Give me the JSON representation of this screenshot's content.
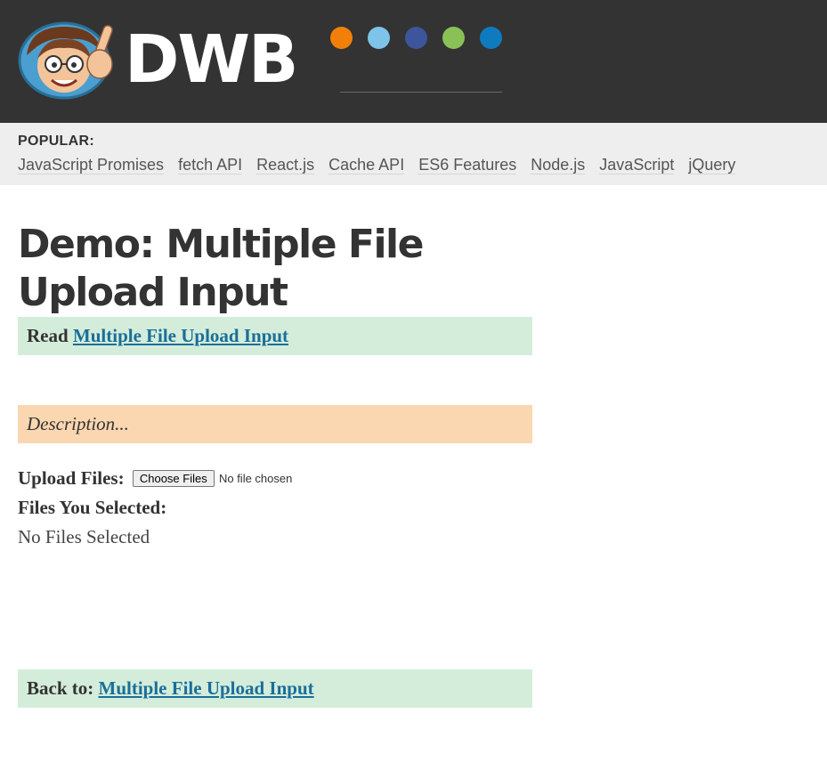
{
  "header": {
    "logo_text": "DWB",
    "mascot": "david-walsh-mascot",
    "dots": [
      {
        "name": "orange-dot",
        "color": "#f28008"
      },
      {
        "name": "lightblue-dot",
        "color": "#7dc4e8"
      },
      {
        "name": "navy-dot",
        "color": "#3c559b"
      },
      {
        "name": "green-dot",
        "color": "#8ac156"
      },
      {
        "name": "blue-dot",
        "color": "#0e7bbe"
      }
    ]
  },
  "popular": {
    "label": "POPULAR:",
    "links": [
      "JavaScript Promises",
      "fetch API",
      "React.js",
      "Cache API",
      "ES6 Features",
      "Node.js",
      "JavaScript",
      "jQuery"
    ]
  },
  "main": {
    "title_line1": "Demo: Multiple File",
    "title_line2": "Upload Input",
    "read_prefix": "Read",
    "read_link": "Multiple File Upload Input",
    "description": "Description...",
    "upload_label": "Upload Files:",
    "choose_button": "Choose Files",
    "no_file_text": "No file chosen",
    "selected_label": "Files You Selected:",
    "selected_value": "No Files Selected",
    "back_prefix": "Back to:",
    "back_link": "Multiple File Upload Input"
  },
  "colors": {
    "header_bg": "#333333",
    "popular_bg": "#eeeeee",
    "success_bar": "#d4edda",
    "description_bar": "#fad7b0",
    "link": "#1a6e9a"
  }
}
